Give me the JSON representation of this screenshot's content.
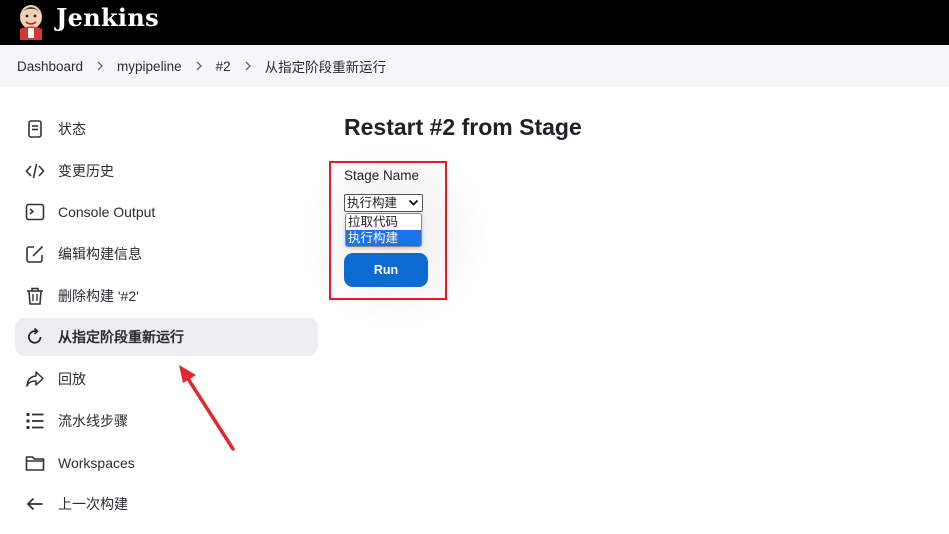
{
  "header": {
    "brand": "Jenkins"
  },
  "breadcrumb": [
    {
      "label": "Dashboard"
    },
    {
      "label": "mypipeline"
    },
    {
      "label": "#2"
    },
    {
      "label": "从指定阶段重新运行"
    }
  ],
  "sidebar": {
    "items": [
      {
        "label": "状态",
        "icon": "status-document-icon"
      },
      {
        "label": "变更历史",
        "icon": "code-icon"
      },
      {
        "label": "Console Output",
        "icon": "terminal-icon"
      },
      {
        "label": "编辑构建信息",
        "icon": "edit-icon"
      },
      {
        "label": "删除构建 '#2'",
        "icon": "trash-icon"
      },
      {
        "label": "从指定阶段重新运行",
        "icon": "restart-icon",
        "active": true
      },
      {
        "label": "回放",
        "icon": "replay-arrow-icon"
      },
      {
        "label": "流水线步骤",
        "icon": "list-icon"
      },
      {
        "label": "Workspaces",
        "icon": "folder-icon"
      },
      {
        "label": "上一次构建",
        "icon": "arrow-left-icon"
      }
    ]
  },
  "main": {
    "title": "Restart #2 from Stage",
    "stage_label": "Stage Name",
    "select_value": "执行构建",
    "options": [
      "拉取代码",
      "执行构建"
    ],
    "selected_option": "执行构建",
    "run_label": "Run"
  },
  "colors": {
    "header_bg": "#000000",
    "breadcrumb_bg": "#f6f6f8",
    "active_item_bg": "#ececf1",
    "run_button": "#0b6bd3",
    "highlight_border": "#e21b24",
    "annotation_arrow": "#e0282e"
  }
}
